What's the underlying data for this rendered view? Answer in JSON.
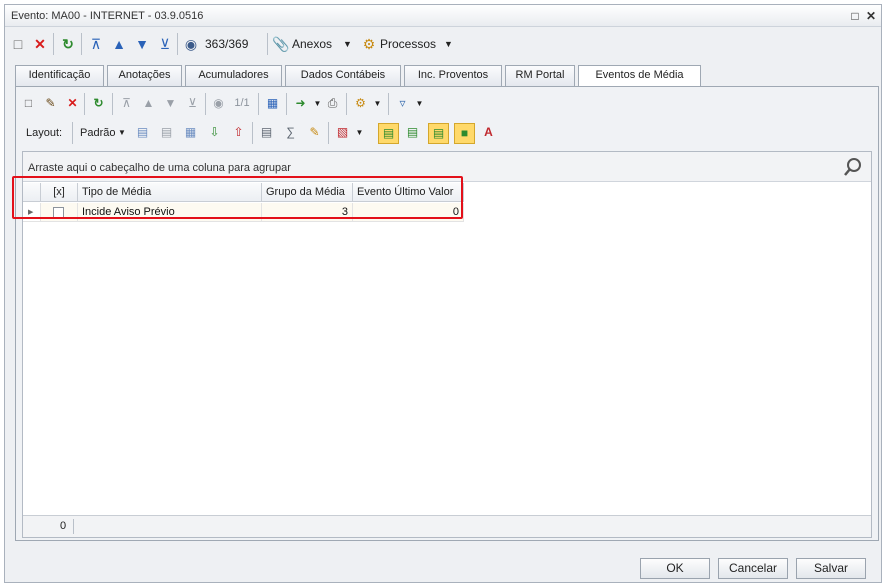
{
  "window": {
    "title": "Evento: MA00 - INTERNET - 03.9.0516",
    "pin_icon": "pin-icon",
    "close_icon": "close-icon"
  },
  "toolbar": {
    "record_position": "363/369",
    "anexos_label": "Anexos",
    "processos_label": "Processos"
  },
  "tabs": [
    {
      "label": "Identificação"
    },
    {
      "label": "Anotações"
    },
    {
      "label": "Acumuladores"
    },
    {
      "label": "Dados Contábeis"
    },
    {
      "label": "Inc. Proventos"
    },
    {
      "label": "RM Portal"
    },
    {
      "label": "Eventos de Média",
      "active": true
    }
  ],
  "grid_toolbar": {
    "page_indicator": "1/1",
    "layout_label": "Layout:",
    "layout_value": "Padrão"
  },
  "grid": {
    "group_hint": "Arraste aqui o cabeçalho de uma coluna para agrupar",
    "columns": [
      "[x]",
      "Tipo de Média",
      "Grupo da Média",
      "Evento Último Valor"
    ],
    "rows": [
      {
        "checked": false,
        "tipo": "Incide Aviso Prévio",
        "grupo": "3",
        "evento": "0"
      }
    ],
    "footer_count": "0"
  },
  "buttons": {
    "ok": "OK",
    "cancel": "Cancelar",
    "save": "Salvar"
  },
  "colors": {
    "highlight": "#e3101a",
    "selected_row": "#fdfaf1"
  }
}
